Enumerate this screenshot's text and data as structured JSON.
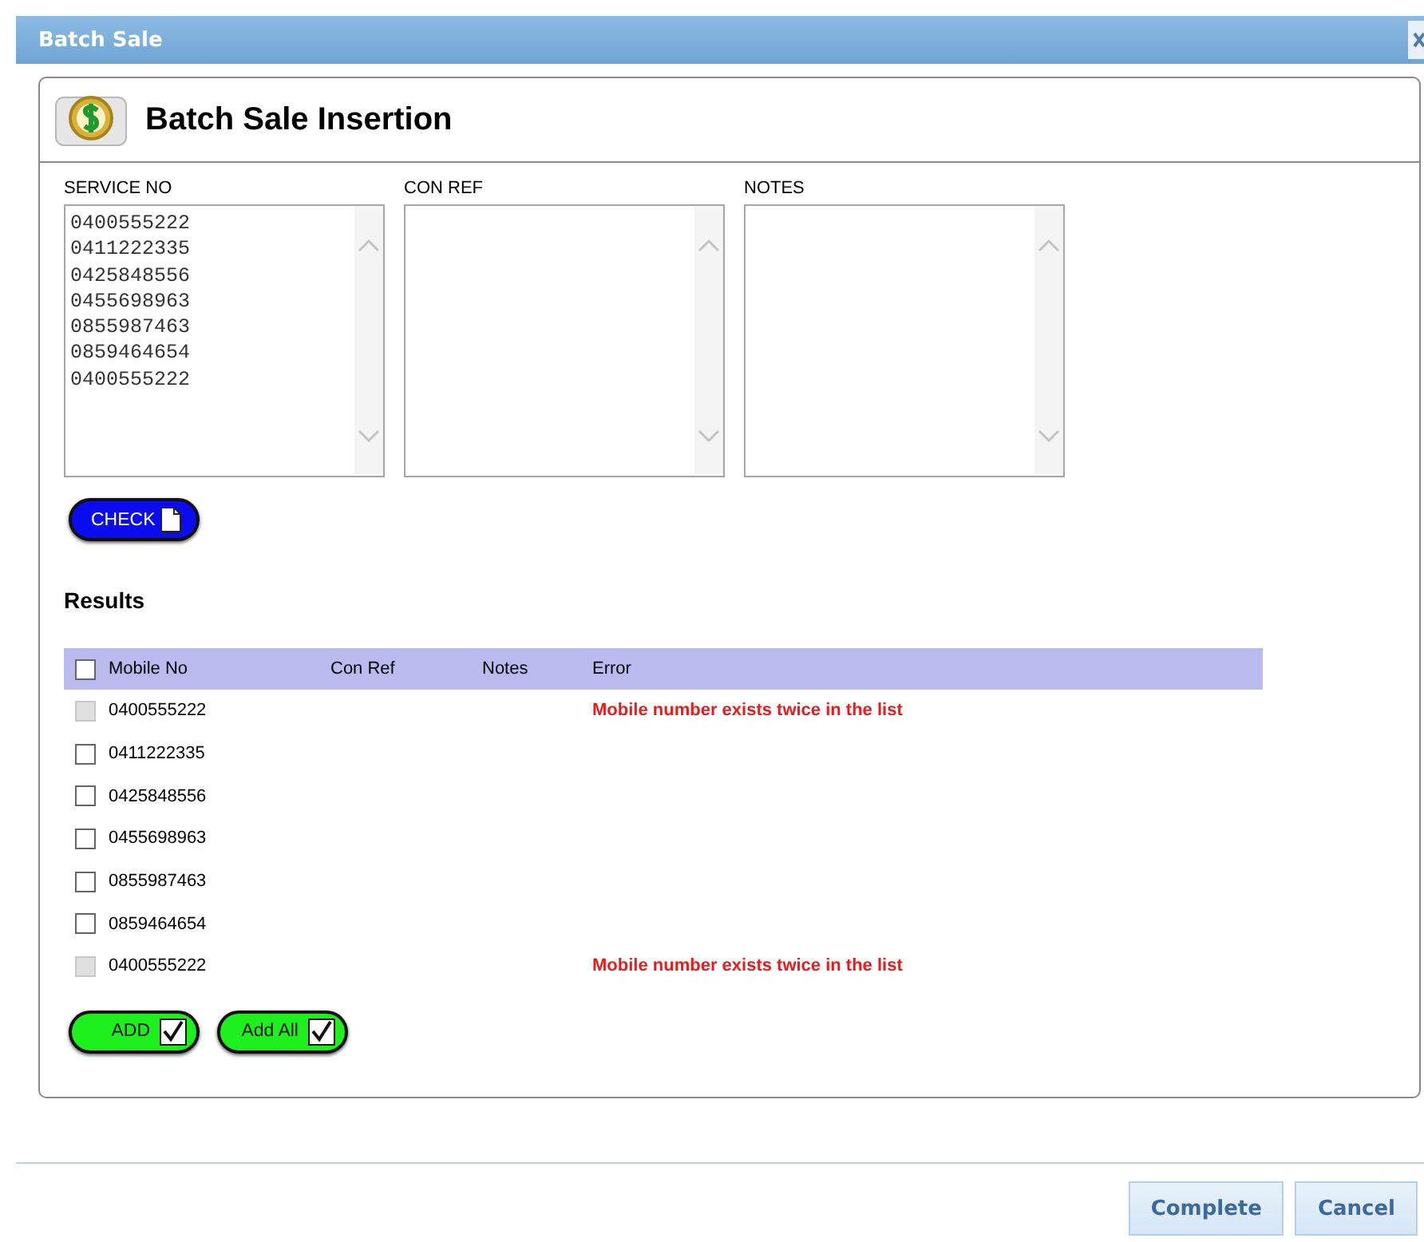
{
  "window": {
    "title": "Batch Sale"
  },
  "header": {
    "title": "Batch Sale Insertion"
  },
  "inputs": [
    {
      "label": "SERVICE NO",
      "value": "0400555222\n0411222335\n0425848556\n0455698963\n0855987463\n0859464654\n0400555222"
    },
    {
      "label": "CON REF"
    },
    {
      "label": "NOTES"
    }
  ],
  "check_button": {
    "label": "CHECK"
  },
  "results": {
    "title": "Results",
    "columns": [
      "Mobile No",
      "Con Ref",
      "Notes",
      "Error"
    ],
    "header_checked": false,
    "rows": [
      {
        "mobile_no": "0400555222",
        "checked": false,
        "disabled": true,
        "error": "Mobile number exists twice in the list"
      },
      {
        "mobile_no": "0411222335",
        "checked": false,
        "disabled": false
      },
      {
        "mobile_no": "0425848556",
        "checked": false,
        "disabled": false
      },
      {
        "mobile_no": "0455698963",
        "checked": false,
        "disabled": false
      },
      {
        "mobile_no": "0855987463",
        "checked": false,
        "disabled": false
      },
      {
        "mobile_no": "0859464654",
        "checked": false,
        "disabled": false
      },
      {
        "mobile_no": "0400555222",
        "checked": false,
        "disabled": true,
        "error": "Mobile number exists twice in the list"
      }
    ]
  },
  "action_buttons": [
    {
      "label": "ADD"
    },
    {
      "label": "Add All"
    }
  ],
  "footer_buttons": [
    {
      "label": "Complete"
    },
    {
      "label": "Cancel"
    }
  ]
}
